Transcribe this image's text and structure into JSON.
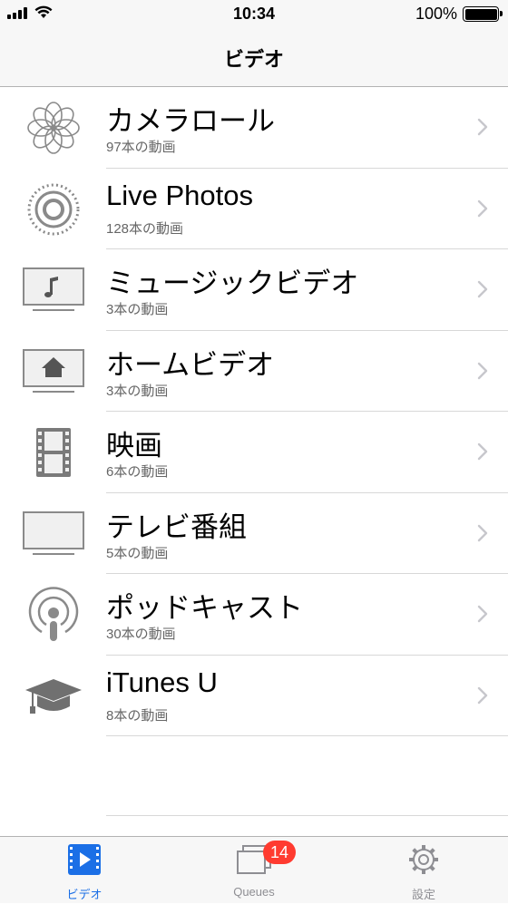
{
  "status": {
    "time": "10:34",
    "battery": "100%"
  },
  "nav": {
    "title": "ビデオ"
  },
  "rows": [
    {
      "title": "カメラロール",
      "subtitle": "97本の動画",
      "icon": "photos-flower-icon"
    },
    {
      "title": "Live Photos",
      "subtitle": "128本の動画",
      "icon": "live-photos-icon"
    },
    {
      "title": "ミュージックビデオ",
      "subtitle": "3本の動画",
      "icon": "music-video-icon"
    },
    {
      "title": "ホームビデオ",
      "subtitle": "3本の動画",
      "icon": "home-video-icon"
    },
    {
      "title": "映画",
      "subtitle": "6本の動画",
      "icon": "film-strip-icon"
    },
    {
      "title": "テレビ番組",
      "subtitle": "5本の動画",
      "icon": "tv-icon"
    },
    {
      "title": "ポッドキャスト",
      "subtitle": "30本の動画",
      "icon": "podcast-icon"
    },
    {
      "title": "iTunes U",
      "subtitle": "8本の動画",
      "icon": "graduation-cap-icon"
    }
  ],
  "tabs": [
    {
      "label": "ビデオ",
      "active": true,
      "icon": "video-play-icon"
    },
    {
      "label": "Queues",
      "badge": "14",
      "icon": "queues-stack-icon"
    },
    {
      "label": "設定",
      "icon": "gear-icon"
    }
  ],
  "colors": {
    "accent": "#1b6fe6",
    "badge": "#ff3b30",
    "icon_gray": "#8a8a8a"
  }
}
